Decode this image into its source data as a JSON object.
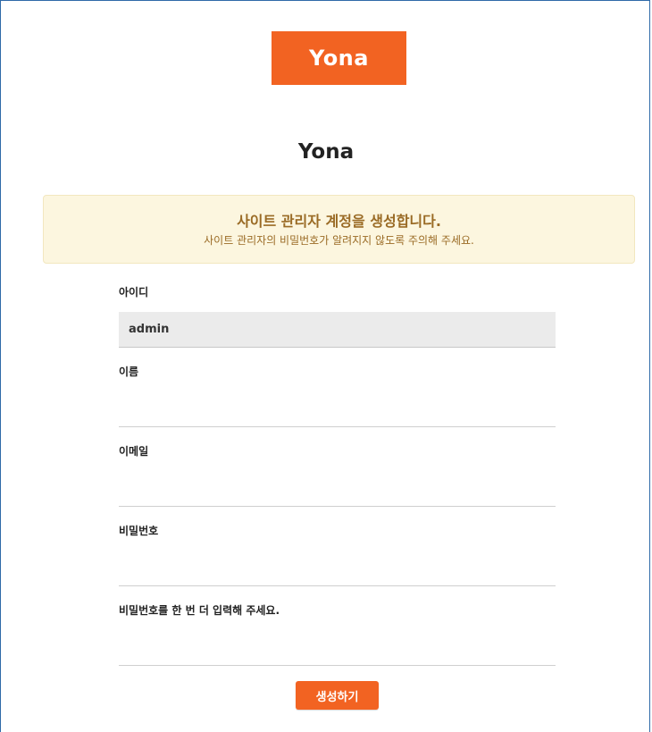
{
  "logo": {
    "text": "Yona"
  },
  "site_title": "Yona",
  "notice": {
    "title": "사이트 관리자 계정을 생성합니다.",
    "description": "사이트 관리자의 비밀번호가 알려지지 않도록 주의해 주세요."
  },
  "form": {
    "fields": [
      {
        "label": "아이디",
        "value": "admin",
        "placeholder": ""
      },
      {
        "label": "이름",
        "value": "",
        "placeholder": ""
      },
      {
        "label": "이메일",
        "value": "",
        "placeholder": ""
      },
      {
        "label": "비밀번호",
        "value": "",
        "placeholder": ""
      },
      {
        "label": "비밀번호를 한 번 더 입력해 주세요.",
        "value": "",
        "placeholder": ""
      }
    ],
    "submit_label": "생성하기"
  },
  "colors": {
    "brand": "#f26322",
    "notice_bg": "#fcf6df",
    "notice_text": "#9a6b25"
  }
}
